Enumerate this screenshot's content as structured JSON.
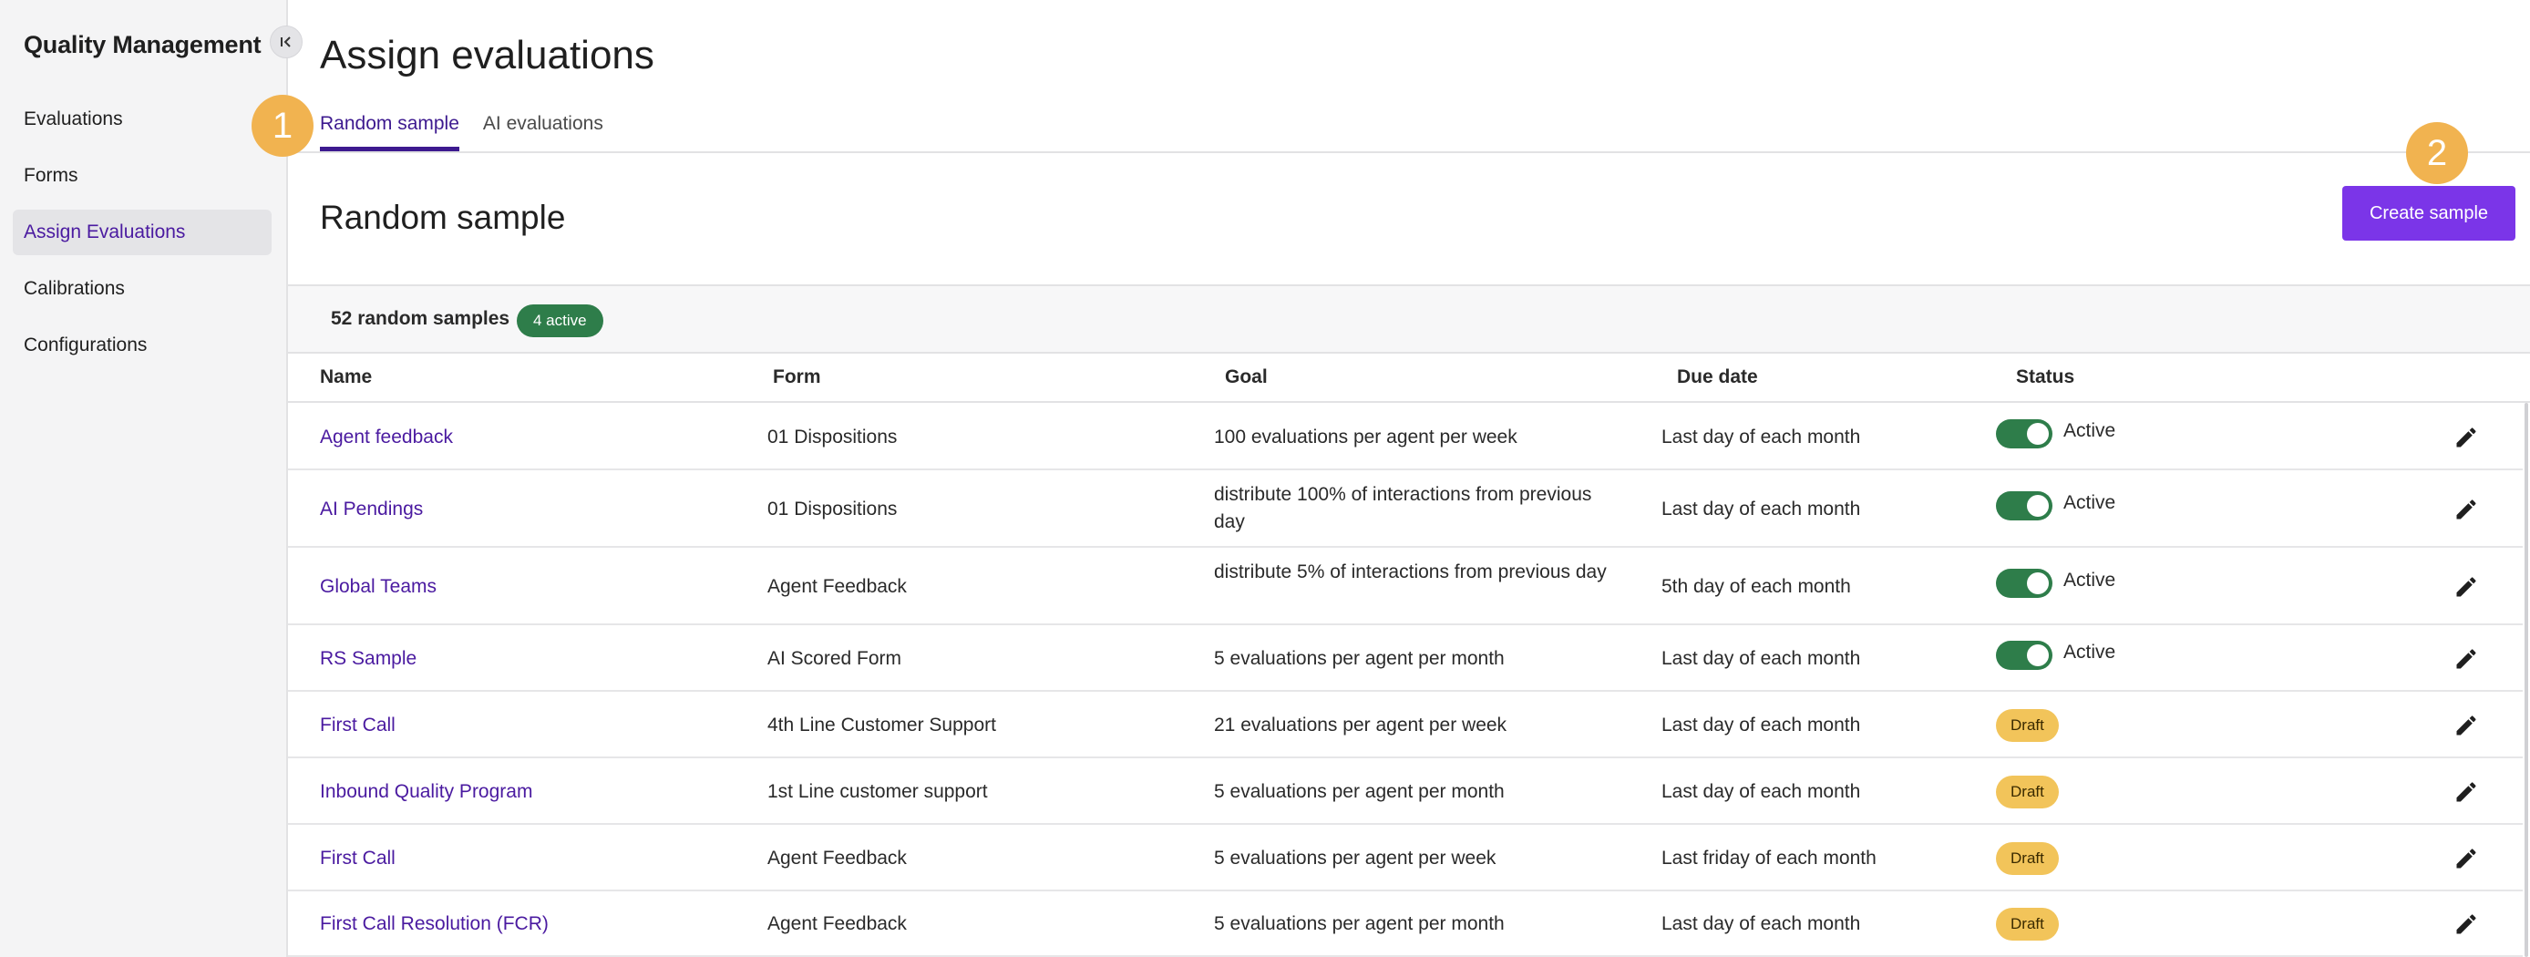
{
  "sidebar": {
    "title": "Quality Management",
    "collapse_icon": "collapse-left-icon",
    "items": [
      {
        "label": "Evaluations"
      },
      {
        "label": "Forms"
      },
      {
        "label": "Assign Evaluations"
      },
      {
        "label": "Calibrations"
      },
      {
        "label": "Configurations"
      }
    ],
    "active_item": "Assign Evaluations"
  },
  "header": {
    "title": "Assign evaluations",
    "tabs": [
      {
        "label": "Random sample"
      },
      {
        "label": "AI evaluations"
      }
    ],
    "active_tab": "Random sample"
  },
  "markers": {
    "one": "1",
    "two": "2"
  },
  "section": {
    "title": "Random sample",
    "create_button": "Create sample"
  },
  "summary": {
    "count_text": "52 random samples",
    "active_badge": "4 active"
  },
  "table": {
    "columns": [
      "Name",
      "Form",
      "Goal",
      "Due date",
      "Status"
    ],
    "rows": [
      {
        "name": "Agent feedback",
        "form": "01 Dispositions",
        "goal": "100 evaluations per agent per week",
        "due": "Last day of each month",
        "status": "Active"
      },
      {
        "name": "AI Pendings",
        "form": "01 Dispositions",
        "goal": "distribute 100% of interactions from previous day",
        "due": "Last day of each month",
        "status": "Active"
      },
      {
        "name": "Global Teams",
        "form": "Agent Feedback",
        "goal": "distribute 5% of interactions from previous day",
        "due": "5th day of each month",
        "status": "Active"
      },
      {
        "name": "RS Sample",
        "form": "AI Scored Form",
        "goal": "5 evaluations per agent per month",
        "due": "Last day of each month",
        "status": "Active"
      },
      {
        "name": "First Call",
        "form": "4th Line Customer Support",
        "goal": "21 evaluations per agent per week",
        "due": "Last day of each month",
        "status": "Draft"
      },
      {
        "name": "Inbound Quality Program",
        "form": "1st Line customer support",
        "goal": "5 evaluations per agent per month",
        "due": "Last day of each month",
        "status": "Draft"
      },
      {
        "name": "First Call",
        "form": "Agent Feedback",
        "goal": "5 evaluations per agent per week",
        "due": "Last friday of each month",
        "status": "Draft"
      },
      {
        "name": "First Call Resolution (FCR)",
        "form": "Agent Feedback",
        "goal": "5 evaluations per agent per month",
        "due": "Last day of each month",
        "status": "Draft"
      }
    ]
  },
  "colors": {
    "accent": "#7b35e8",
    "link": "#4a1aa0",
    "active_green": "#2e7d4a",
    "draft_yellow": "#f2c45a",
    "marker_orange": "#f1b350"
  },
  "icons": {
    "edit": "pencil-icon",
    "collapse": "collapse-left-icon"
  }
}
